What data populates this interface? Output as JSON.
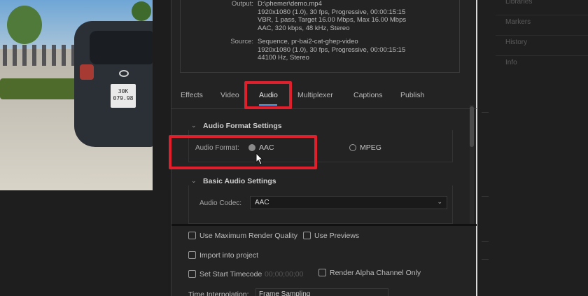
{
  "summary": {
    "output_label": "Output:",
    "output_lines": [
      "D:\\phemer\\demo.mp4",
      "1920x1080 (1.0), 30 fps, Progressive, 00:00:15:15",
      "VBR, 1 pass, Target 16.00 Mbps, Max 16.00 Mbps",
      "AAC, 320 kbps, 48 kHz, Stereo"
    ],
    "source_label": "Source:",
    "source_lines": [
      "Sequence, pr-bai2-cat-ghep-video",
      "1920x1080 (1.0), 30 fps, Progressive, 00:00:15:15",
      "44100 Hz, Stereo"
    ]
  },
  "tabs": [
    "Effects",
    "Video",
    "Audio",
    "Multiplexer",
    "Captions",
    "Publish"
  ],
  "active_tab": "Audio",
  "audio_format_settings": {
    "title": "Audio Format Settings",
    "format_label": "Audio Format:",
    "options": [
      "AAC",
      "MPEG"
    ],
    "selected": "AAC"
  },
  "basic_audio_settings": {
    "title": "Basic Audio Settings",
    "codec_label": "Audio Codec:",
    "codec_value": "AAC"
  },
  "bottom_options": {
    "max_render_quality": "Use Maximum Render Quality",
    "use_previews": "Use Previews",
    "import_into_project": "Import into project",
    "set_start_timecode": "Set Start Timecode",
    "start_timecode_value": "00;00;00;00",
    "render_alpha": "Render Alpha Channel Only",
    "time_interpolation_label": "Time Interpolation:",
    "time_interpolation_value": "Frame Sampling"
  },
  "preview": {
    "plate_text": "30K\n079.98"
  },
  "right_panel": {
    "items": [
      "Libraries",
      "Markers",
      "History",
      "Info"
    ]
  },
  "colors": {
    "highlight": "#e01f2c",
    "tab_underline": "#5aa0e6",
    "panel_bg": "#232323"
  }
}
